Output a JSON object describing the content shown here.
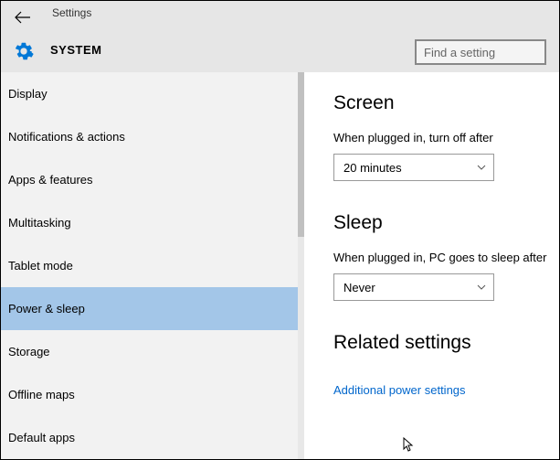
{
  "header": {
    "title": "Settings",
    "section": "SYSTEM",
    "search_placeholder": "Find a setting"
  },
  "sidebar": {
    "items": [
      {
        "label": "Display"
      },
      {
        "label": "Notifications & actions"
      },
      {
        "label": "Apps & features"
      },
      {
        "label": "Multitasking"
      },
      {
        "label": "Tablet mode"
      },
      {
        "label": "Power & sleep"
      },
      {
        "label": "Storage"
      },
      {
        "label": "Offline maps"
      },
      {
        "label": "Default apps"
      }
    ],
    "selected_index": 5
  },
  "main": {
    "screen": {
      "heading": "Screen",
      "label": "When plugged in, turn off after",
      "value": "20 minutes"
    },
    "sleep": {
      "heading": "Sleep",
      "label": "When plugged in, PC goes to sleep after",
      "value": "Never"
    },
    "related": {
      "heading": "Related settings",
      "link": "Additional power settings"
    }
  }
}
